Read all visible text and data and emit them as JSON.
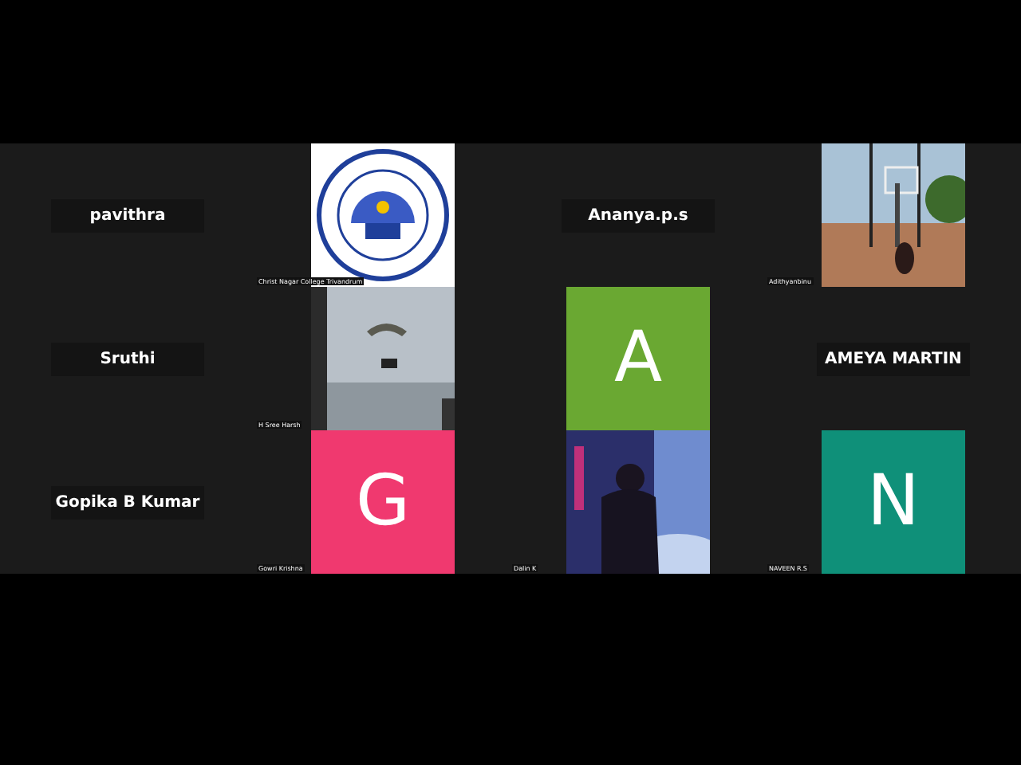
{
  "tiles": [
    {
      "kind": "name",
      "name": "pavithra"
    },
    {
      "kind": "picture",
      "label": "Christ Nagar College Trivandrum"
    },
    {
      "kind": "name",
      "name": "Ananya.p.s"
    },
    {
      "kind": "picture",
      "label": "Adithyanbinu"
    },
    {
      "kind": "name",
      "name": "Sruthi"
    },
    {
      "kind": "picture",
      "label": "H Sree Harsh"
    },
    {
      "kind": "avatar",
      "letter": "A",
      "color": "#6aa832"
    },
    {
      "kind": "name",
      "name": "AMEYA MARTIN"
    },
    {
      "kind": "name",
      "name": "Gopika B Kumar"
    },
    {
      "kind": "avatar",
      "letter": "G",
      "color": "#f0396f",
      "label": "Gowri Krishna"
    },
    {
      "kind": "picture",
      "label": "Dalin K"
    },
    {
      "kind": "avatar",
      "letter": "N",
      "color": "#0f9079",
      "label": "NAVEEN R.S"
    }
  ]
}
